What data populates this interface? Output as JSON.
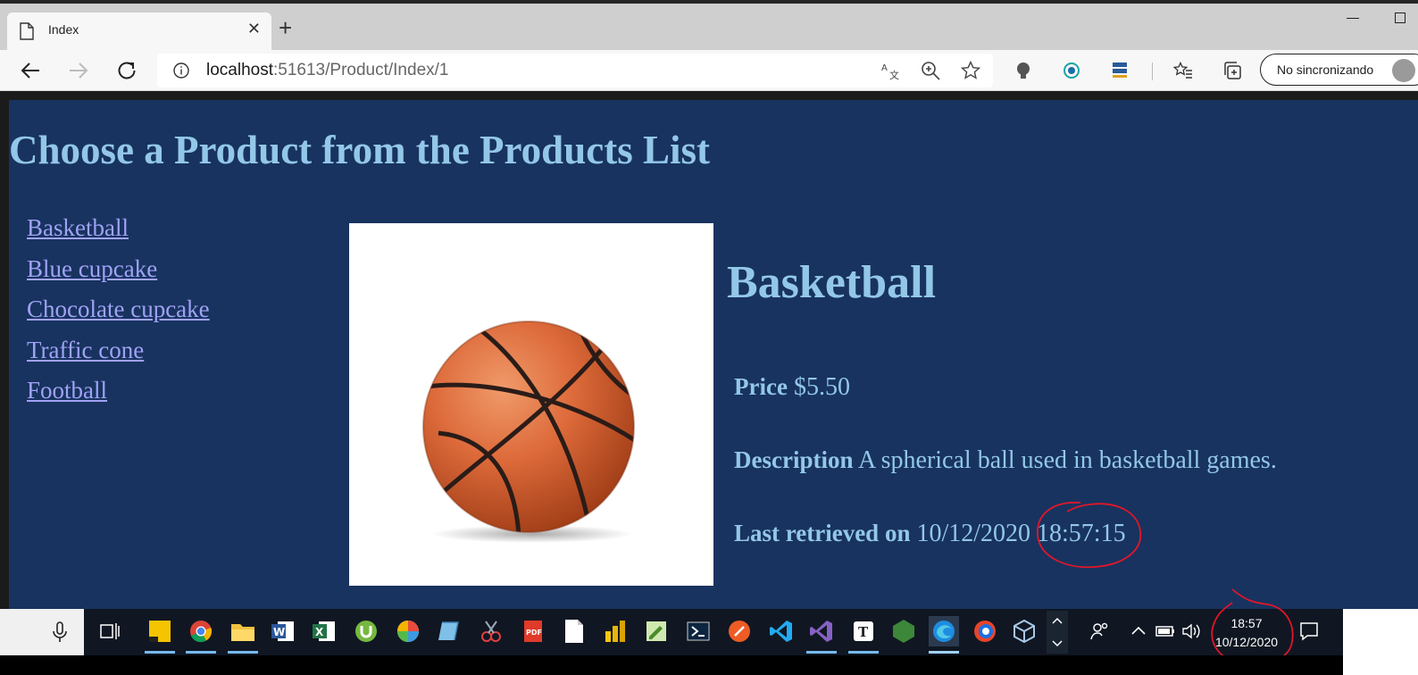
{
  "browser": {
    "tab_title": "Index",
    "tab_close": "✕",
    "new_tab": "+",
    "url_host": "localhost",
    "url_rest": ":51613/Product/Index/1",
    "sync_label": "No sincronizando"
  },
  "page": {
    "title": "Choose a Product from the Products List",
    "products": [
      "Basketball",
      "Blue cupcake",
      "Chocolate cupcake",
      "Traffic cone",
      "Football"
    ],
    "selected": {
      "name": "Basketball",
      "price_label": "Price",
      "price": "$5.50",
      "description_label": "Description",
      "description": "A spherical ball used in basketball games.",
      "retrieved_label": "Last retrieved on",
      "retrieved": "10/12/2020 18:57:15"
    }
  },
  "taskbar": {
    "time": "18:57",
    "date": "10/12/2020",
    "apps": [
      "sticky-notes-icon",
      "chrome-icon",
      "file-explorer-icon",
      "word-icon",
      "excel-icon",
      "utorrent-icon",
      "pinwheel-icon",
      "notes-icon",
      "snipping-tool-icon",
      "pdf-icon",
      "blank-doc-icon",
      "power-bi-icon",
      "editor-icon",
      "powershell-icon",
      "postman-icon",
      "vscode-icon",
      "visual-studio-icon",
      "typora-icon",
      "nodejs-icon",
      "edge-icon",
      "firefox-dev-icon",
      "virtualbox-icon"
    ]
  },
  "colors": {
    "page_bg": "#18335f",
    "heading": "#93c7e8",
    "link": "#a0a2f5",
    "annotation": "#e0162b"
  }
}
